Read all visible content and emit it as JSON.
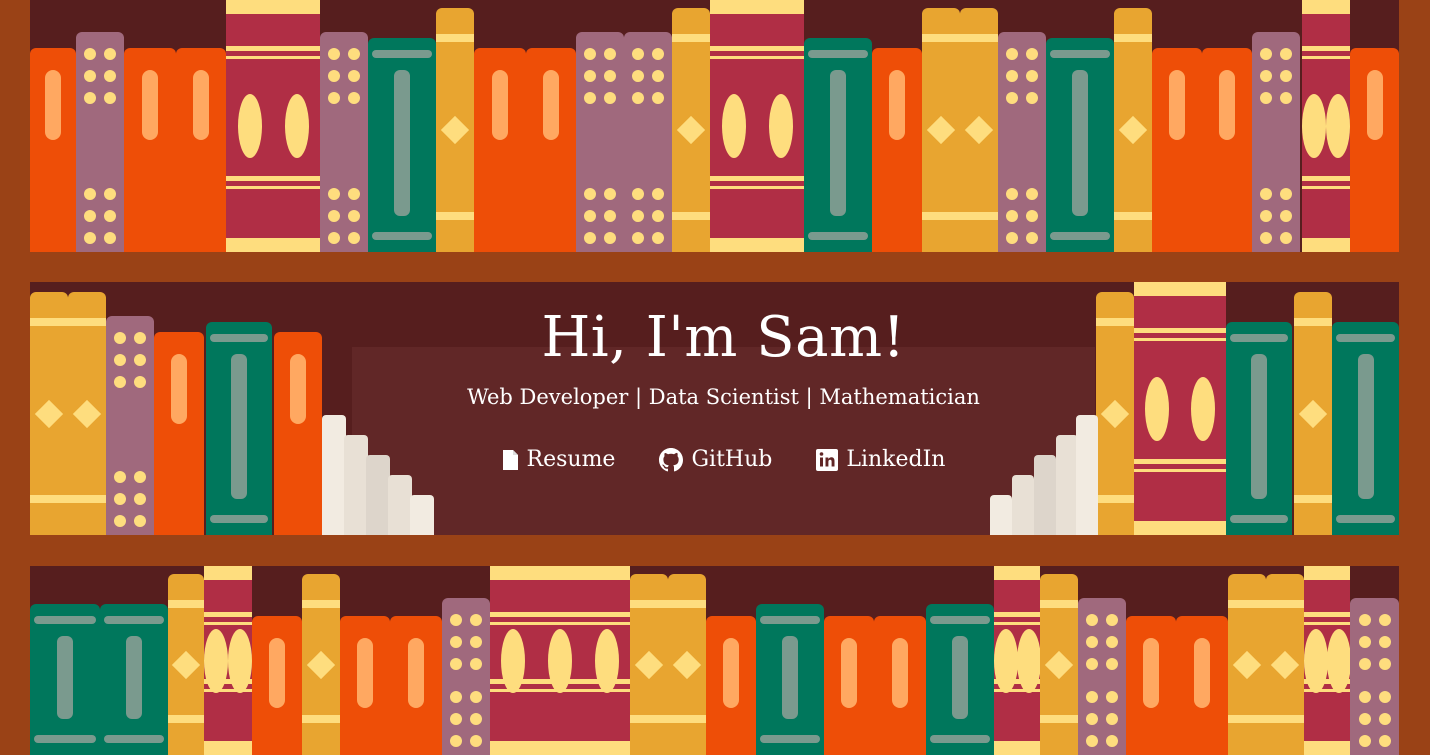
{
  "hero": {
    "title": "Hi, I'm Sam!",
    "subtitle": "Web Developer | Data Scientist | Mathematician"
  },
  "links": [
    {
      "label": "Resume",
      "icon": "file-icon"
    },
    {
      "label": "GitHub",
      "icon": "github-icon"
    },
    {
      "label": "LinkedIn",
      "icon": "linkedin-icon"
    }
  ],
  "colors": {
    "wood": "#9A4216",
    "shelf_back": "#561E1E",
    "panel": "#612727",
    "orange": "#EE4E07",
    "mauve": "#A0697D",
    "crimson": "#B02E45",
    "green": "#00775C",
    "gold": "#E8A530",
    "cream": "#FEDD7E"
  }
}
